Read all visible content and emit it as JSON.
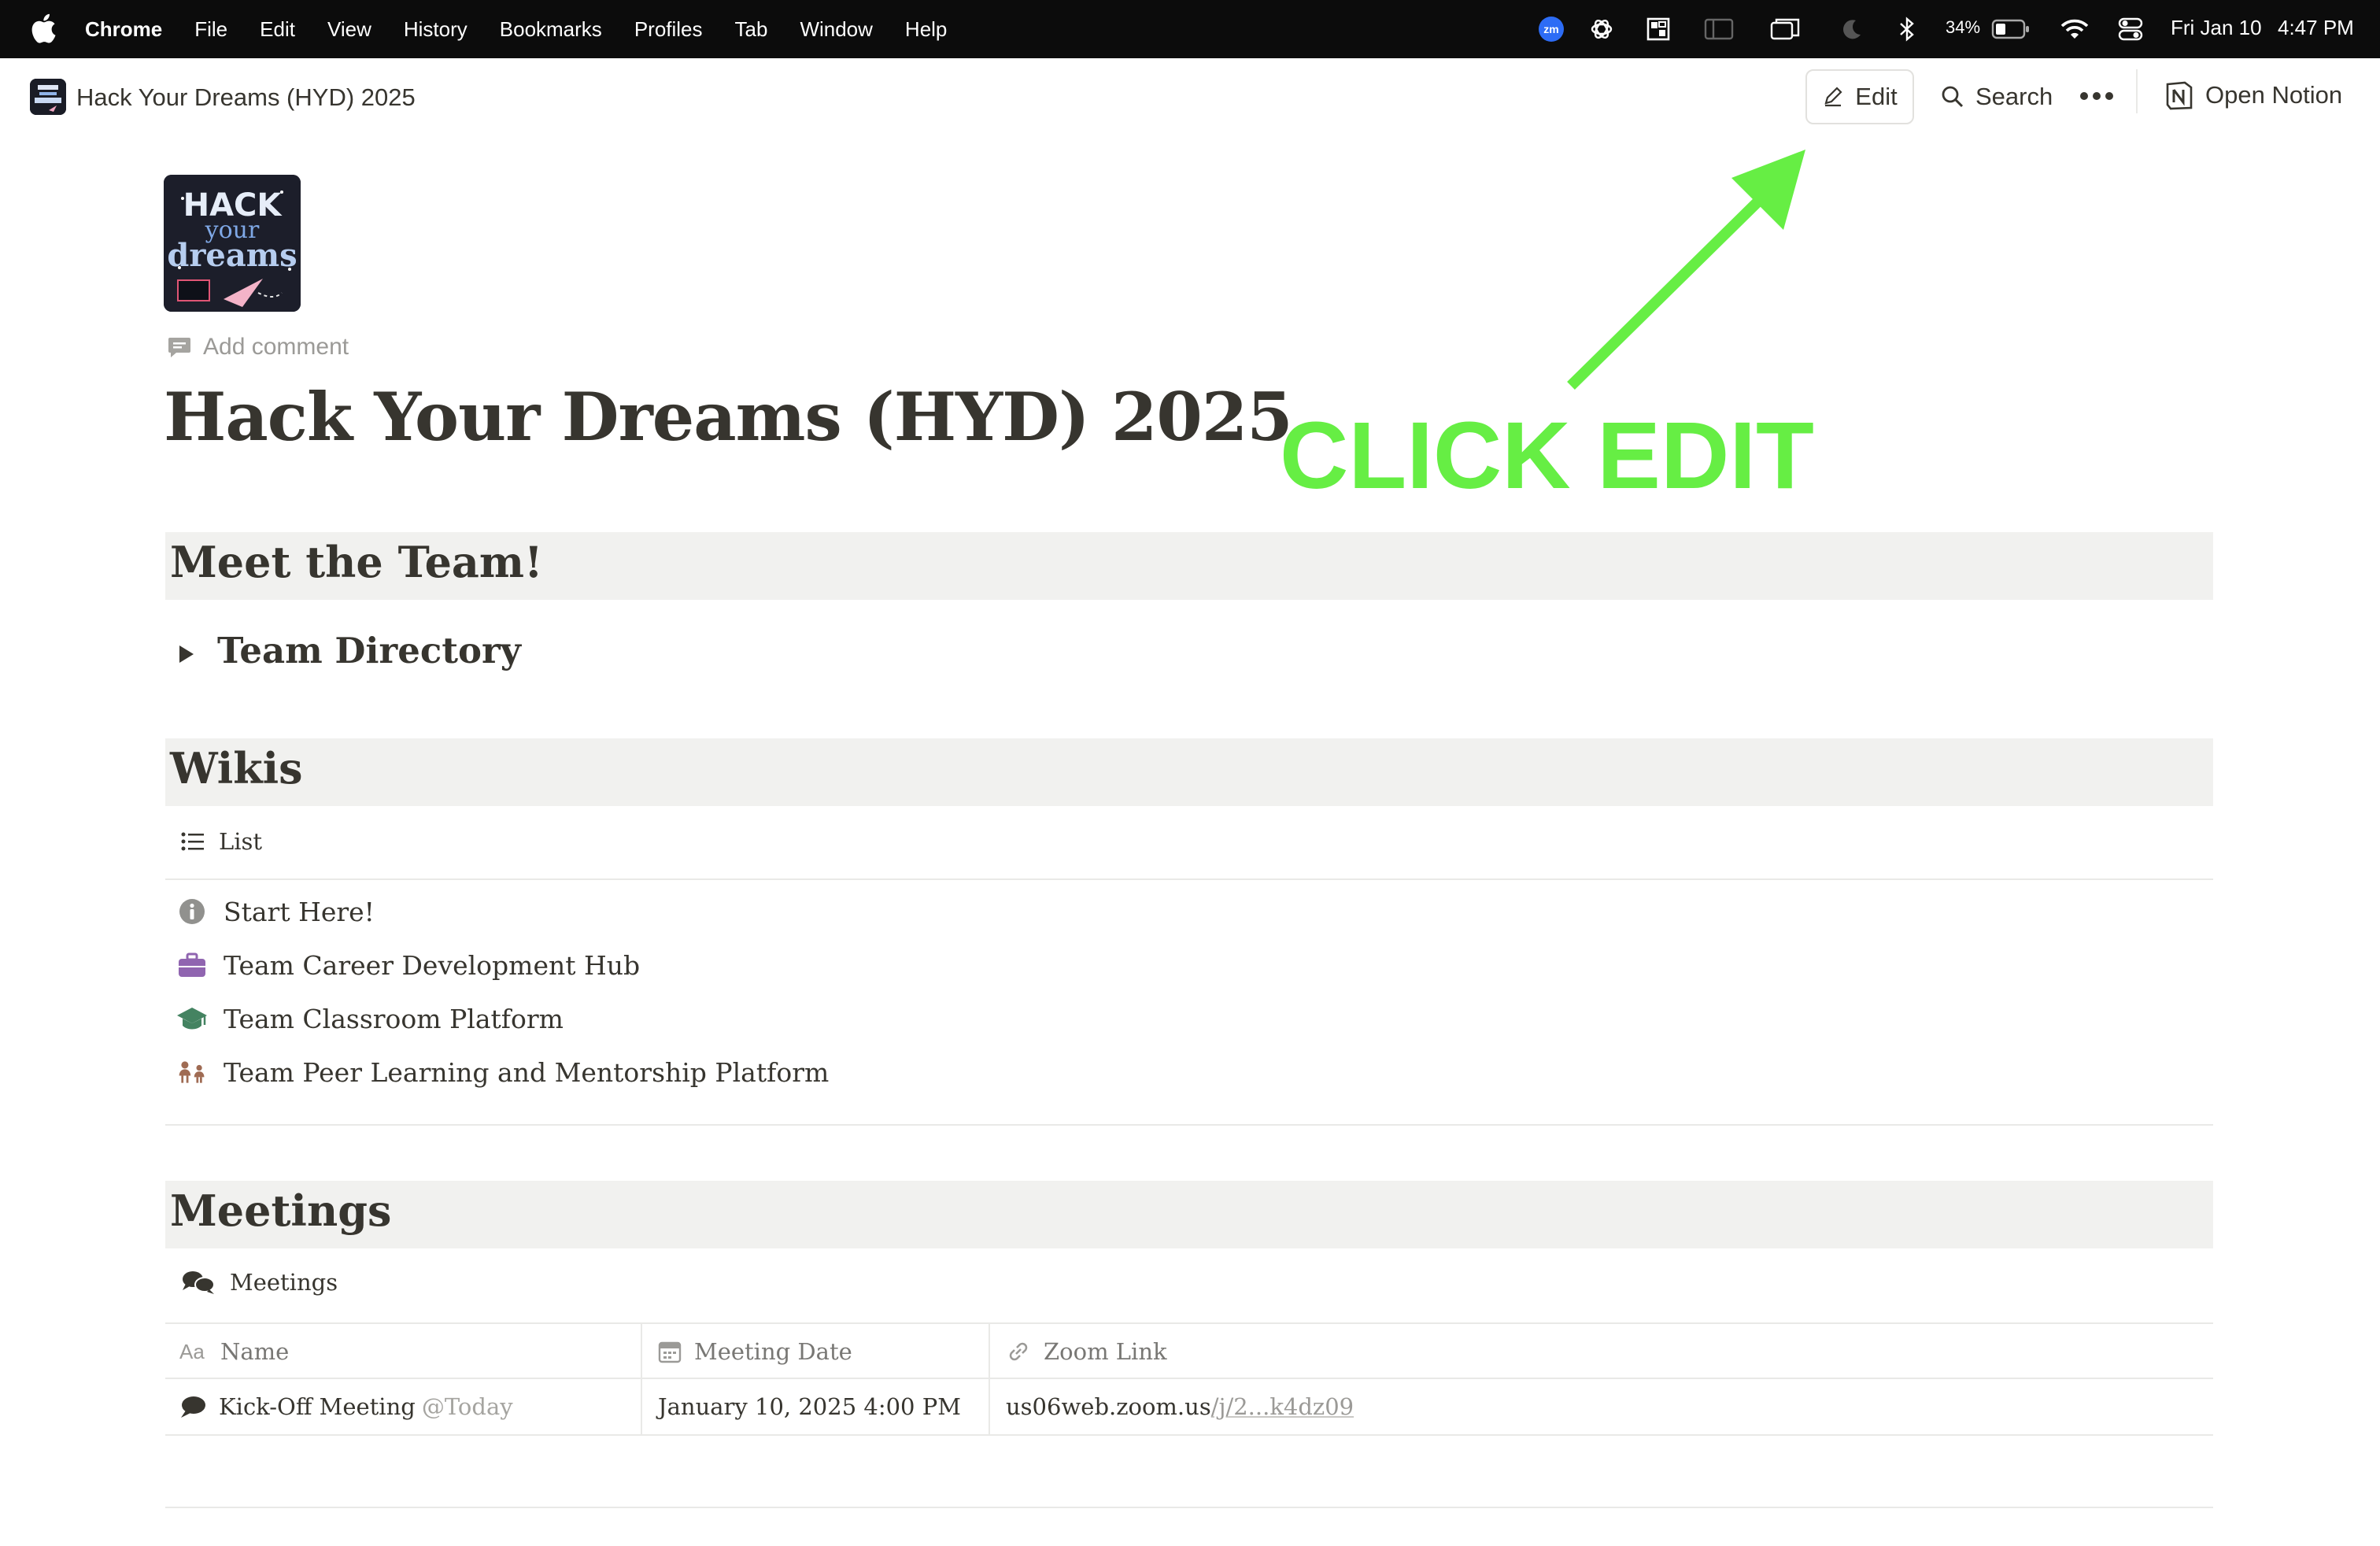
{
  "menubar": {
    "app": "Chrome",
    "menus": [
      "File",
      "Edit",
      "View",
      "History",
      "Bookmarks",
      "Profiles",
      "Tab",
      "Window",
      "Help"
    ],
    "zoom_badge": "zm",
    "battery_percent": "34%",
    "date": "Fri Jan 10",
    "time": "4:47 PM",
    "icons": [
      "apple-icon",
      "zoom-icon",
      "chatgpt-icon",
      "window-layout-icon",
      "sidebar-icon",
      "screen-mirror-icon",
      "moon-icon",
      "bluetooth-icon",
      "battery-icon",
      "wifi-icon",
      "control-center-icon"
    ]
  },
  "topbar": {
    "breadcrumb_title": "Hack Your Dreams (HYD) 2025",
    "edit_label": "Edit",
    "search_label": "Search",
    "open_notion_label": "Open Notion"
  },
  "page": {
    "icon_text_1": "HACK",
    "icon_text_2": "your",
    "icon_text_3": "dreams",
    "add_comment": "Add comment",
    "title": "Hack Your Dreams (HYD) 2025"
  },
  "annotation": {
    "text": "CLICK EDIT",
    "color": "#66ee44"
  },
  "sections": {
    "team": {
      "heading": "Meet the Team!",
      "toggle_label": "Team Directory"
    },
    "wikis": {
      "heading": "Wikis",
      "view_label": "List",
      "items": [
        {
          "label": "Start Here!",
          "icon": "info-icon"
        },
        {
          "label": "Team Career Development Hub",
          "icon": "briefcase-icon"
        },
        {
          "label": "Team Classroom Platform",
          "icon": "graduation-cap-icon"
        },
        {
          "label": "Team Peer Learning and Mentorship Platform",
          "icon": "people-icon"
        }
      ]
    },
    "meetings": {
      "heading": "Meetings",
      "view_label": "Meetings",
      "columns": [
        {
          "label": "Name",
          "icon": "text-type-icon"
        },
        {
          "label": "Meeting Date",
          "icon": "calendar-icon"
        },
        {
          "label": "Zoom Link",
          "icon": "link-icon"
        }
      ],
      "rows": [
        {
          "name": "Kick-Off Meeting",
          "mention": "@Today",
          "date": "January 10, 2025 4:00 PM",
          "link_main": "us06web.zoom.us",
          "link_rest": "/j/2...k4dz09"
        }
      ]
    }
  }
}
